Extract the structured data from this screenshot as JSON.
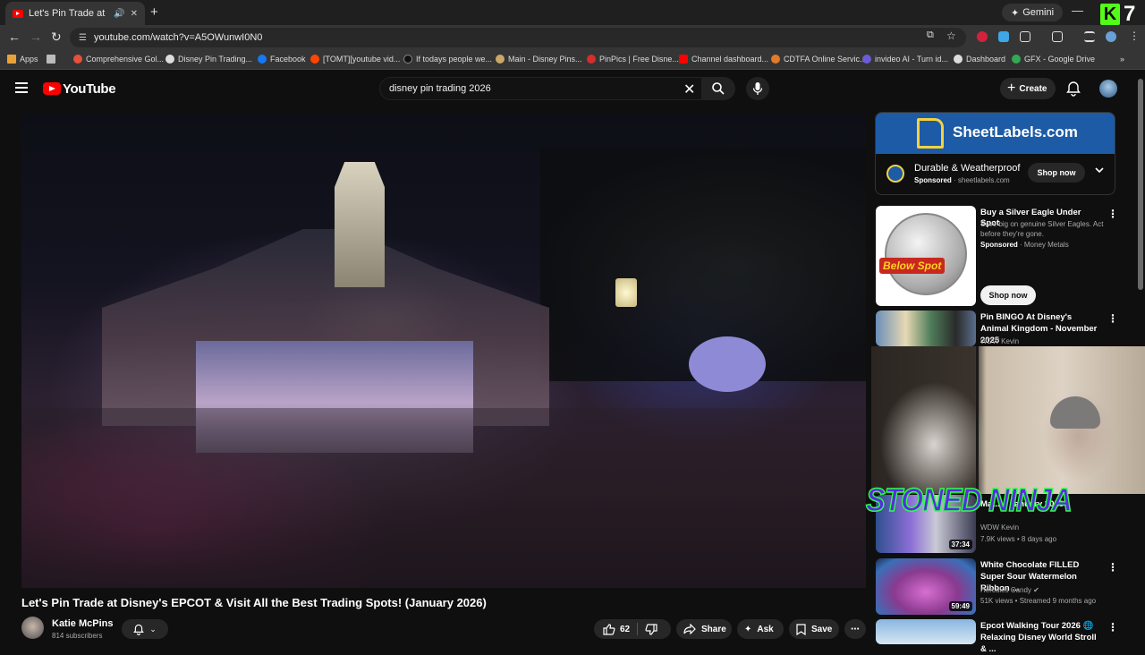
{
  "browser": {
    "tab_title": "Let's Pin Trade at Disney's E",
    "url": "youtube.com/watch?v=A5OWunwI0N0",
    "gemini_label": "Gemini",
    "bookmarks": [
      "Apps",
      "Comprehensive Gol...",
      "Disney Pin Trading...",
      "Facebook",
      "[TOMT][youtube vid...",
      "If todays people we...",
      "Main - Disney Pins...",
      "PinPics | Free Disne...",
      "Channel dashboard...",
      "CDTFA Online Servic...",
      "invideo AI - Turn id...",
      "Dashboard",
      "GFX - Google Drive"
    ]
  },
  "header": {
    "logo_text": "YouTube",
    "search_value": "disney pin trading 2026",
    "create_label": "Create"
  },
  "video": {
    "title": "Let's Pin Trade at Disney's EPCOT & Visit All the Best Trading Spots! (January 2026)",
    "channel_name": "Katie McPins",
    "subscribers": "814 subscribers",
    "likes": "62",
    "share_label": "Share",
    "ask_label": "Ask",
    "save_label": "Save"
  },
  "sidebar": {
    "ad": {
      "brand": "SheetLabels.com",
      "title": "Durable & Weatherproof",
      "sponsored": "Sponsored",
      "domain": "sheetlabels.com",
      "cta": "Shop now"
    },
    "promo": {
      "badge": "Below Spot",
      "title": "Buy a Silver Eagle Under Spot",
      "desc": "Save big on genuine Silver Eagles. Act before they're gone.",
      "sponsored": "Sponsored",
      "advertiser": "Money Metals",
      "cta": "Shop now"
    },
    "recs": [
      {
        "title": "Pin BINGO At Disney's Animal Kingdom - November 2025",
        "channel": "WDW Kevin",
        "meta": "",
        "duration": ""
      },
      {
        "title": "Mat... - January 2026",
        "channel": "WDW Kevin",
        "meta": "7.9K views • 8 days ago",
        "duration": "37:34"
      },
      {
        "title": "White Chocolate FILLED Super Sour Watermelon Ribbon ...",
        "channel": "Hercules Candy",
        "meta": "51K views • Streamed 9 months ago",
        "duration": "59:49"
      },
      {
        "title": "Epcot Walking Tour 2026 🌐 Relaxing Disney World Stroll & ...",
        "channel": "",
        "meta": "",
        "duration": ""
      }
    ]
  },
  "overlay": {
    "stream_text": "STONED NINJA",
    "corner_number": "7"
  }
}
